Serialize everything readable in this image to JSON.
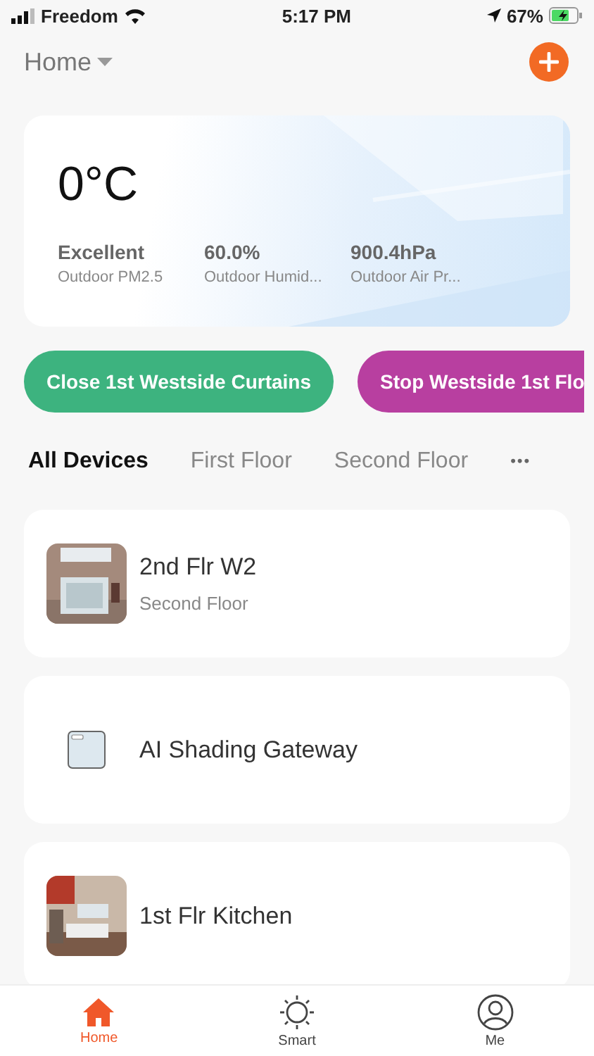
{
  "status_bar": {
    "carrier": "Freedom",
    "time": "5:17 PM",
    "battery": "67%"
  },
  "header": {
    "home": "Home"
  },
  "weather": {
    "temperature": "0°C",
    "stats": [
      {
        "value": "Excellent",
        "label": "Outdoor PM2.5"
      },
      {
        "value": "60.0%",
        "label": "Outdoor Humid..."
      },
      {
        "value": "900.4hPa",
        "label": "Outdoor Air Pr..."
      }
    ]
  },
  "scenes": [
    {
      "label": "Close 1st Westside Curtains",
      "color": "#3db37f"
    },
    {
      "label": "Stop Westside 1st Flo",
      "color": "#b83fa0"
    }
  ],
  "tabs": [
    {
      "label": "All Devices",
      "selected": true
    },
    {
      "label": "First Floor",
      "selected": false
    },
    {
      "label": "Second Floor",
      "selected": false
    }
  ],
  "tabs_more": "•••",
  "devices": [
    {
      "kind": "picture",
      "name": "2nd Flr W2",
      "room": "Second Floor"
    },
    {
      "kind": "gateway",
      "name": "AI Shading Gateway"
    },
    {
      "kind": "picture",
      "name": "1st Flr Kitchen"
    }
  ],
  "bottom_nav": [
    {
      "label": "Home",
      "kind": "home",
      "selected": true
    },
    {
      "label": "Smart",
      "kind": "smart",
      "selected": false
    },
    {
      "label": "Me",
      "kind": "me",
      "selected": false
    }
  ]
}
